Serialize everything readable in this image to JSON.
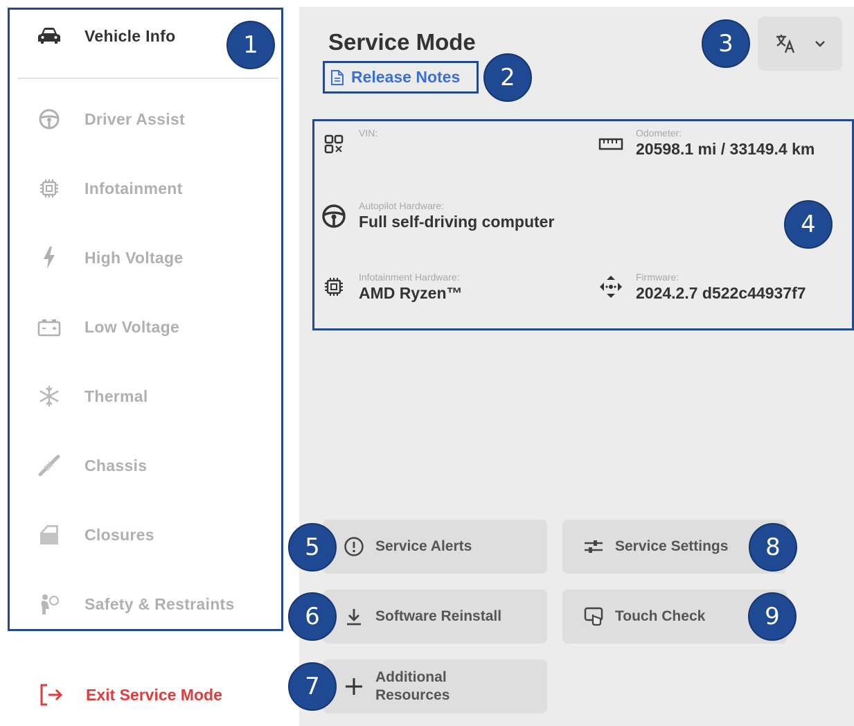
{
  "sidebar": {
    "items": [
      {
        "label": "Vehicle Info",
        "icon": "car-icon",
        "active": true
      },
      {
        "label": "Driver Assist",
        "icon": "steering-wheel-icon"
      },
      {
        "label": "Infotainment",
        "icon": "chip-icon"
      },
      {
        "label": "High Voltage",
        "icon": "lightning-bolt-icon"
      },
      {
        "label": "Low Voltage",
        "icon": "battery-icon"
      },
      {
        "label": "Thermal",
        "icon": "snowflake-icon"
      },
      {
        "label": "Chassis",
        "icon": "shock-absorber-icon"
      },
      {
        "label": "Closures",
        "icon": "car-door-icon"
      },
      {
        "label": "Safety & Restraints",
        "icon": "airbag-icon"
      }
    ],
    "exit_label": "Exit Service Mode"
  },
  "main": {
    "title": "Service Mode",
    "release_notes_label": "Release Notes",
    "language_icon": "translate-icon",
    "info": {
      "vin": {
        "label": "VIN:",
        "value": ""
      },
      "odometer": {
        "label": "Odometer:",
        "value": "20598.1 mi / 33149.4 km"
      },
      "autopilot": {
        "label": "Autopilot Hardware:",
        "value": "Full self-driving computer"
      },
      "infotainment": {
        "label": "Infotainment Hardware:",
        "value": "AMD Ryzen™"
      },
      "firmware": {
        "label": "Firmware:",
        "value": "2024.2.7 d522c44937f7"
      }
    },
    "actions": {
      "service_alerts": "Service Alerts",
      "software_reinstall": "Software Reinstall",
      "additional_resources_line1": "Additional",
      "additional_resources_line2": "Resources",
      "service_settings": "Service Settings",
      "touch_check": "Touch Check"
    }
  },
  "annotations": [
    "1",
    "2",
    "3",
    "4",
    "5",
    "6",
    "7",
    "8",
    "9"
  ],
  "colors": {
    "accent_link": "#3b6fd8",
    "exit_red": "#e23b3b",
    "annotation_blue": "#1f4a93",
    "panel_bg": "#ececec",
    "button_bg": "#dedede"
  }
}
